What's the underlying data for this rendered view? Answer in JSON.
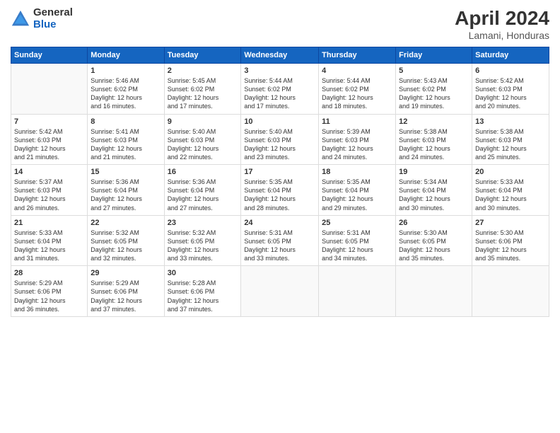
{
  "header": {
    "logo_general": "General",
    "logo_blue": "Blue",
    "month_title": "April 2024",
    "location": "Lamani, Honduras"
  },
  "days_of_week": [
    "Sunday",
    "Monday",
    "Tuesday",
    "Wednesday",
    "Thursday",
    "Friday",
    "Saturday"
  ],
  "weeks": [
    [
      {
        "day": "",
        "info": ""
      },
      {
        "day": "1",
        "info": "Sunrise: 5:46 AM\nSunset: 6:02 PM\nDaylight: 12 hours\nand 16 minutes."
      },
      {
        "day": "2",
        "info": "Sunrise: 5:45 AM\nSunset: 6:02 PM\nDaylight: 12 hours\nand 17 minutes."
      },
      {
        "day": "3",
        "info": "Sunrise: 5:44 AM\nSunset: 6:02 PM\nDaylight: 12 hours\nand 17 minutes."
      },
      {
        "day": "4",
        "info": "Sunrise: 5:44 AM\nSunset: 6:02 PM\nDaylight: 12 hours\nand 18 minutes."
      },
      {
        "day": "5",
        "info": "Sunrise: 5:43 AM\nSunset: 6:02 PM\nDaylight: 12 hours\nand 19 minutes."
      },
      {
        "day": "6",
        "info": "Sunrise: 5:42 AM\nSunset: 6:03 PM\nDaylight: 12 hours\nand 20 minutes."
      }
    ],
    [
      {
        "day": "7",
        "info": "Sunrise: 5:42 AM\nSunset: 6:03 PM\nDaylight: 12 hours\nand 21 minutes."
      },
      {
        "day": "8",
        "info": "Sunrise: 5:41 AM\nSunset: 6:03 PM\nDaylight: 12 hours\nand 21 minutes."
      },
      {
        "day": "9",
        "info": "Sunrise: 5:40 AM\nSunset: 6:03 PM\nDaylight: 12 hours\nand 22 minutes."
      },
      {
        "day": "10",
        "info": "Sunrise: 5:40 AM\nSunset: 6:03 PM\nDaylight: 12 hours\nand 23 minutes."
      },
      {
        "day": "11",
        "info": "Sunrise: 5:39 AM\nSunset: 6:03 PM\nDaylight: 12 hours\nand 24 minutes."
      },
      {
        "day": "12",
        "info": "Sunrise: 5:38 AM\nSunset: 6:03 PM\nDaylight: 12 hours\nand 24 minutes."
      },
      {
        "day": "13",
        "info": "Sunrise: 5:38 AM\nSunset: 6:03 PM\nDaylight: 12 hours\nand 25 minutes."
      }
    ],
    [
      {
        "day": "14",
        "info": "Sunrise: 5:37 AM\nSunset: 6:03 PM\nDaylight: 12 hours\nand 26 minutes."
      },
      {
        "day": "15",
        "info": "Sunrise: 5:36 AM\nSunset: 6:04 PM\nDaylight: 12 hours\nand 27 minutes."
      },
      {
        "day": "16",
        "info": "Sunrise: 5:36 AM\nSunset: 6:04 PM\nDaylight: 12 hours\nand 27 minutes."
      },
      {
        "day": "17",
        "info": "Sunrise: 5:35 AM\nSunset: 6:04 PM\nDaylight: 12 hours\nand 28 minutes."
      },
      {
        "day": "18",
        "info": "Sunrise: 5:35 AM\nSunset: 6:04 PM\nDaylight: 12 hours\nand 29 minutes."
      },
      {
        "day": "19",
        "info": "Sunrise: 5:34 AM\nSunset: 6:04 PM\nDaylight: 12 hours\nand 30 minutes."
      },
      {
        "day": "20",
        "info": "Sunrise: 5:33 AM\nSunset: 6:04 PM\nDaylight: 12 hours\nand 30 minutes."
      }
    ],
    [
      {
        "day": "21",
        "info": "Sunrise: 5:33 AM\nSunset: 6:04 PM\nDaylight: 12 hours\nand 31 minutes."
      },
      {
        "day": "22",
        "info": "Sunrise: 5:32 AM\nSunset: 6:05 PM\nDaylight: 12 hours\nand 32 minutes."
      },
      {
        "day": "23",
        "info": "Sunrise: 5:32 AM\nSunset: 6:05 PM\nDaylight: 12 hours\nand 33 minutes."
      },
      {
        "day": "24",
        "info": "Sunrise: 5:31 AM\nSunset: 6:05 PM\nDaylight: 12 hours\nand 33 minutes."
      },
      {
        "day": "25",
        "info": "Sunrise: 5:31 AM\nSunset: 6:05 PM\nDaylight: 12 hours\nand 34 minutes."
      },
      {
        "day": "26",
        "info": "Sunrise: 5:30 AM\nSunset: 6:05 PM\nDaylight: 12 hours\nand 35 minutes."
      },
      {
        "day": "27",
        "info": "Sunrise: 5:30 AM\nSunset: 6:06 PM\nDaylight: 12 hours\nand 35 minutes."
      }
    ],
    [
      {
        "day": "28",
        "info": "Sunrise: 5:29 AM\nSunset: 6:06 PM\nDaylight: 12 hours\nand 36 minutes."
      },
      {
        "day": "29",
        "info": "Sunrise: 5:29 AM\nSunset: 6:06 PM\nDaylight: 12 hours\nand 37 minutes."
      },
      {
        "day": "30",
        "info": "Sunrise: 5:28 AM\nSunset: 6:06 PM\nDaylight: 12 hours\nand 37 minutes."
      },
      {
        "day": "",
        "info": ""
      },
      {
        "day": "",
        "info": ""
      },
      {
        "day": "",
        "info": ""
      },
      {
        "day": "",
        "info": ""
      }
    ]
  ]
}
